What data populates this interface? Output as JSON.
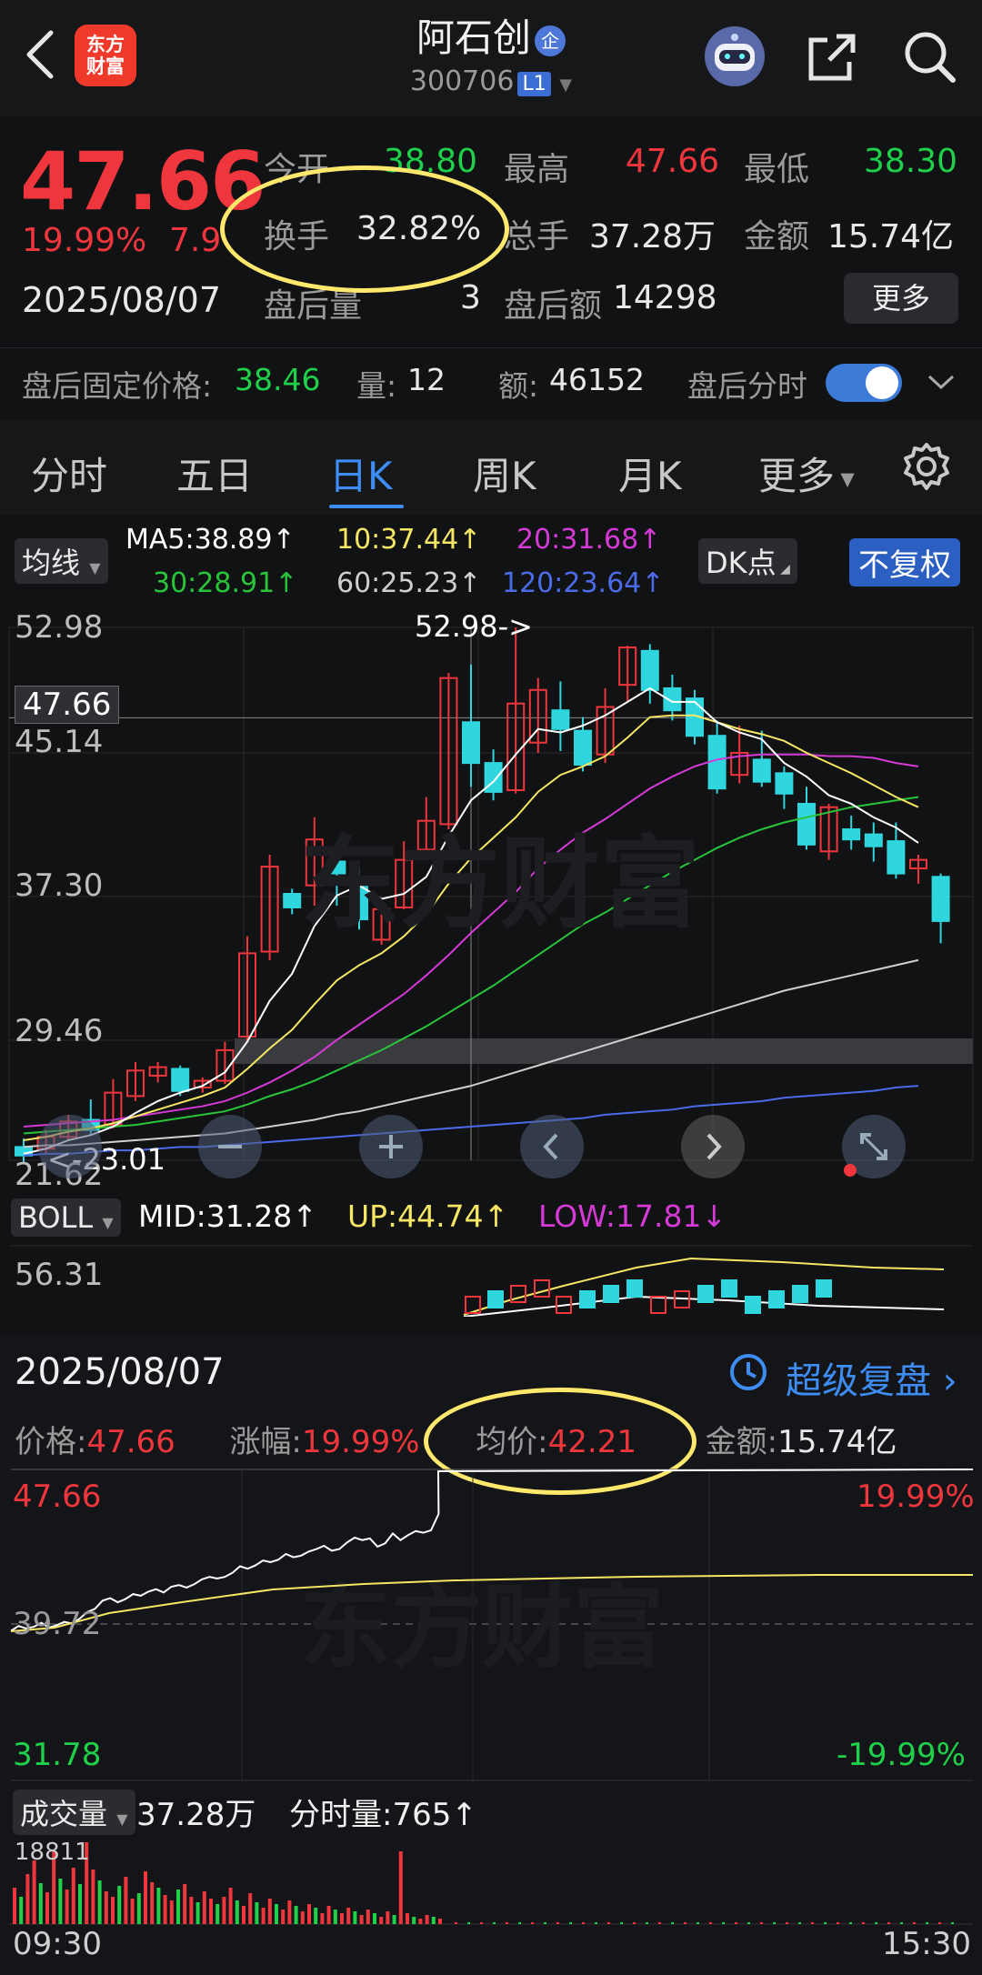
{
  "header": {
    "title": "阿石创",
    "qi_badge": "企",
    "code": "300706",
    "level_badge": "L1",
    "logo_text_1": "东方",
    "logo_text_2": "财富",
    "icons": [
      "back-arrow-icon",
      "robot-avatar-icon",
      "share-icon",
      "search-icon"
    ]
  },
  "quote": {
    "price": "47.66",
    "change_pct": "19.99%",
    "change_amt": "7.9",
    "date": "2025/08/07",
    "open_label": "今开",
    "open": "38.80",
    "high_label": "最高",
    "high": "47.66",
    "low_label": "最低",
    "low": "38.30",
    "turnover_label": "换手",
    "turnover": "32.82%",
    "volume_label": "总手",
    "volume": "37.28万",
    "amount_label": "金额",
    "amount": "15.74亿",
    "after_vol_label": "盘后量",
    "after_vol": "3",
    "after_amt_label": "盘后额",
    "after_amt": "14298",
    "more": "更多"
  },
  "after_hours": {
    "fixed_label": "盘后固定价格:",
    "fixed_price": "38.46",
    "qty_label": "量:",
    "qty": "12",
    "amt_label": "额:",
    "amt": "46152",
    "toggle_label": "盘后分时",
    "toggle_on": true
  },
  "tabs": [
    "分时",
    "五日",
    "日K",
    "周K",
    "月K",
    "更多"
  ],
  "active_tab": "日K",
  "indicators": {
    "ma_chip": "均线",
    "ma5": "MA5:38.89↑",
    "ma10": "10:37.44↑",
    "ma20": "20:31.68↑",
    "ma30": "30:28.91↑",
    "ma60": "60:25.23↑",
    "ma120": "120:23.64↑",
    "dk_button": "DK点",
    "fq_button": "不复权",
    "colors": {
      "ma5": "#ffffff",
      "ma10": "#f5e663",
      "ma20": "#d63ad6",
      "ma30": "#28c43a",
      "ma60": "#cfcfcf",
      "ma120": "#4b6be8"
    }
  },
  "kline": {
    "y_ticks": [
      "52.98",
      "45.14",
      "37.30",
      "29.46",
      "21.62"
    ],
    "current_price_tag": "47.66",
    "high_marker": "52.98->",
    "low_marker": "<-23.01"
  },
  "boll": {
    "chip": "BOLL",
    "mid": "MID:31.28↑",
    "up": "UP:44.74↑",
    "low": "LOW:17.81↓",
    "y_tick": "56.31"
  },
  "intraday": {
    "date": "2025/08/07",
    "replay_link": "超级复盘",
    "price_label": "价格:",
    "price": "47.66",
    "chg_label": "涨幅:",
    "chg": "19.99%",
    "avg_label": "均价:",
    "avg": "42.21",
    "amt_label": "金额:",
    "amt": "15.74亿",
    "y_top": "47.66",
    "y_mid": "39.72",
    "y_bot": "31.78",
    "pct_top": "19.99%",
    "pct_bot": "-19.99%",
    "vol_chip": "成交量",
    "vol_total": "37.28万",
    "tick_vol": "分时量:765↑",
    "vol_max": "18811",
    "time_start": "09:30",
    "time_end": "15:30"
  },
  "chart_data": {
    "type": "candlestick",
    "ylim": [
      21.62,
      52.98
    ],
    "candles": [
      {
        "o": 22.4,
        "c": 21.9,
        "h": 22.9,
        "l": 21.4
      },
      {
        "o": 22.3,
        "c": 23.0,
        "h": 23.4,
        "l": 22.0
      },
      {
        "o": 23.0,
        "c": 23.9,
        "h": 24.3,
        "l": 22.8
      },
      {
        "o": 24.0,
        "c": 23.4,
        "h": 25.2,
        "l": 23.1
      },
      {
        "o": 23.7,
        "c": 25.6,
        "h": 26.4,
        "l": 23.5
      },
      {
        "o": 25.4,
        "c": 26.9,
        "h": 27.4,
        "l": 25.1
      },
      {
        "o": 26.6,
        "c": 27.1,
        "h": 27.4,
        "l": 26.2
      },
      {
        "o": 27.0,
        "c": 25.7,
        "h": 27.2,
        "l": 25.4
      },
      {
        "o": 25.9,
        "c": 26.3,
        "h": 26.5,
        "l": 25.6
      },
      {
        "o": 26.3,
        "c": 28.1,
        "h": 28.6,
        "l": 26.1
      },
      {
        "o": 28.9,
        "c": 33.8,
        "h": 34.8,
        "l": 28.6
      },
      {
        "o": 33.9,
        "c": 38.9,
        "h": 39.6,
        "l": 33.4
      },
      {
        "o": 37.3,
        "c": 36.5,
        "h": 37.6,
        "l": 36.1
      },
      {
        "o": 37.8,
        "c": 40.5,
        "h": 41.8,
        "l": 36.6
      },
      {
        "o": 39.2,
        "c": 38.5,
        "h": 40.3,
        "l": 36.6
      },
      {
        "o": 38.2,
        "c": 35.8,
        "h": 38.8,
        "l": 35.2
      },
      {
        "o": 34.6,
        "c": 36.4,
        "h": 36.8,
        "l": 34.3
      },
      {
        "o": 36.5,
        "c": 39.3,
        "h": 40.4,
        "l": 36.4
      },
      {
        "o": 39.9,
        "c": 41.6,
        "h": 43.0,
        "l": 39.3
      },
      {
        "o": 41.4,
        "c": 50.0,
        "h": 50.3,
        "l": 41.1
      },
      {
        "o": 47.4,
        "c": 45.0,
        "h": 50.8,
        "l": 43.6
      },
      {
        "o": 45.0,
        "c": 43.3,
        "h": 45.8,
        "l": 42.8
      },
      {
        "o": 43.4,
        "c": 48.5,
        "h": 52.98,
        "l": 43.2
      },
      {
        "o": 46.2,
        "c": 49.3,
        "h": 50.0,
        "l": 45.6
      },
      {
        "o": 48.1,
        "c": 47.0,
        "h": 49.8,
        "l": 45.7
      },
      {
        "o": 46.9,
        "c": 44.9,
        "h": 47.7,
        "l": 44.5
      },
      {
        "o": 45.5,
        "c": 48.3,
        "h": 49.4,
        "l": 45.0
      },
      {
        "o": 49.6,
        "c": 51.8,
        "h": 51.9,
        "l": 48.6
      },
      {
        "o": 51.6,
        "c": 49.3,
        "h": 52.0,
        "l": 48.5
      },
      {
        "o": 49.4,
        "c": 48.1,
        "h": 50.2,
        "l": 47.5
      },
      {
        "o": 48.8,
        "c": 46.6,
        "h": 49.3,
        "l": 46.1
      },
      {
        "o": 46.6,
        "c": 43.5,
        "h": 47.5,
        "l": 43.2
      },
      {
        "o": 44.3,
        "c": 45.6,
        "h": 47.2,
        "l": 43.8
      },
      {
        "o": 45.2,
        "c": 43.9,
        "h": 46.9,
        "l": 43.6
      },
      {
        "o": 44.4,
        "c": 43.2,
        "h": 44.8,
        "l": 42.3
      },
      {
        "o": 42.6,
        "c": 40.2,
        "h": 43.6,
        "l": 39.9
      },
      {
        "o": 39.8,
        "c": 42.4,
        "h": 42.6,
        "l": 39.3
      },
      {
        "o": 41.1,
        "c": 40.5,
        "h": 41.9,
        "l": 39.9
      },
      {
        "o": 40.8,
        "c": 40.1,
        "h": 41.5,
        "l": 39.2
      },
      {
        "o": 40.4,
        "c": 38.5,
        "h": 41.5,
        "l": 38.2
      },
      {
        "o": 38.8,
        "c": 39.3,
        "h": 39.6,
        "l": 37.9
      },
      {
        "o": 38.3,
        "c": 35.7,
        "h": 38.5,
        "l": 34.4
      }
    ],
    "ma5": [
      22.0,
      22.3,
      22.8,
      23.1,
      23.6,
      24.4,
      25.1,
      25.6,
      26.0,
      26.8,
      28.6,
      31.0,
      32.6,
      35.4,
      37.2,
      37.8,
      37.0,
      37.3,
      38.3,
      40.7,
      42.8,
      43.9,
      45.5,
      47.0,
      46.8,
      47.2,
      47.8,
      48.6,
      49.4,
      48.6,
      48.6,
      47.4,
      46.8,
      46.4,
      45.0,
      44.2,
      43.1,
      42.6,
      41.8,
      41.2,
      40.3
    ],
    "ma10": [
      22.8,
      23.0,
      23.3,
      23.5,
      23.8,
      24.2,
      24.6,
      25.0,
      25.4,
      25.9,
      27.0,
      28.2,
      29.3,
      30.8,
      32.2,
      33.1,
      33.8,
      34.8,
      36.1,
      37.9,
      39.4,
      40.6,
      41.8,
      43.3,
      44.3,
      44.8,
      45.4,
      46.5,
      47.7,
      47.8,
      47.8,
      47.4,
      47.0,
      46.7,
      46.3,
      45.6,
      45.0,
      44.4,
      43.7,
      43.0,
      42.4
    ],
    "ma20": [
      23.6,
      23.7,
      23.8,
      23.9,
      24.0,
      24.2,
      24.4,
      24.6,
      24.8,
      25.1,
      25.6,
      26.2,
      26.9,
      27.7,
      28.7,
      29.6,
      30.5,
      31.4,
      32.5,
      33.7,
      35.0,
      36.2,
      37.4,
      38.8,
      39.9,
      40.9,
      41.7,
      42.6,
      43.5,
      44.2,
      44.8,
      45.2,
      45.4,
      45.5,
      45.5,
      45.5,
      45.4,
      45.4,
      45.3,
      45.0,
      44.8
    ],
    "ma30": [
      23.2,
      23.3,
      23.4,
      23.5,
      23.6,
      23.7,
      23.9,
      24.1,
      24.3,
      24.5,
      24.9,
      25.4,
      25.8,
      26.3,
      26.9,
      27.5,
      28.1,
      28.8,
      29.5,
      30.3,
      31.1,
      31.9,
      32.8,
      33.7,
      34.6,
      35.5,
      36.2,
      37.0,
      37.8,
      38.6,
      39.3,
      40.0,
      40.6,
      41.1,
      41.5,
      41.8,
      42.1,
      42.4,
      42.6,
      42.8,
      43.0
    ],
    "ma60": [
      22.4,
      22.5,
      22.5,
      22.6,
      22.7,
      22.8,
      22.9,
      23.0,
      23.1,
      23.2,
      23.4,
      23.6,
      23.8,
      24.0,
      24.3,
      24.5,
      24.8,
      25.1,
      25.4,
      25.7,
      26.0,
      26.4,
      26.8,
      27.2,
      27.6,
      28.0,
      28.4,
      28.8,
      29.2,
      29.6,
      30.0,
      30.4,
      30.8,
      31.2,
      31.6,
      31.9,
      32.2,
      32.5,
      32.8,
      33.1,
      33.4
    ],
    "ma120": [
      21.9,
      22.0,
      22.0,
      22.1,
      22.2,
      22.2,
      22.3,
      22.4,
      22.4,
      22.5,
      22.6,
      22.7,
      22.8,
      22.9,
      23.0,
      23.1,
      23.2,
      23.3,
      23.4,
      23.5,
      23.6,
      23.7,
      23.8,
      23.9,
      24.0,
      24.1,
      24.3,
      24.4,
      24.5,
      24.6,
      24.8,
      24.9,
      25.0,
      25.1,
      25.3,
      25.4,
      25.5,
      25.6,
      25.7,
      25.9,
      26.0
    ]
  }
}
